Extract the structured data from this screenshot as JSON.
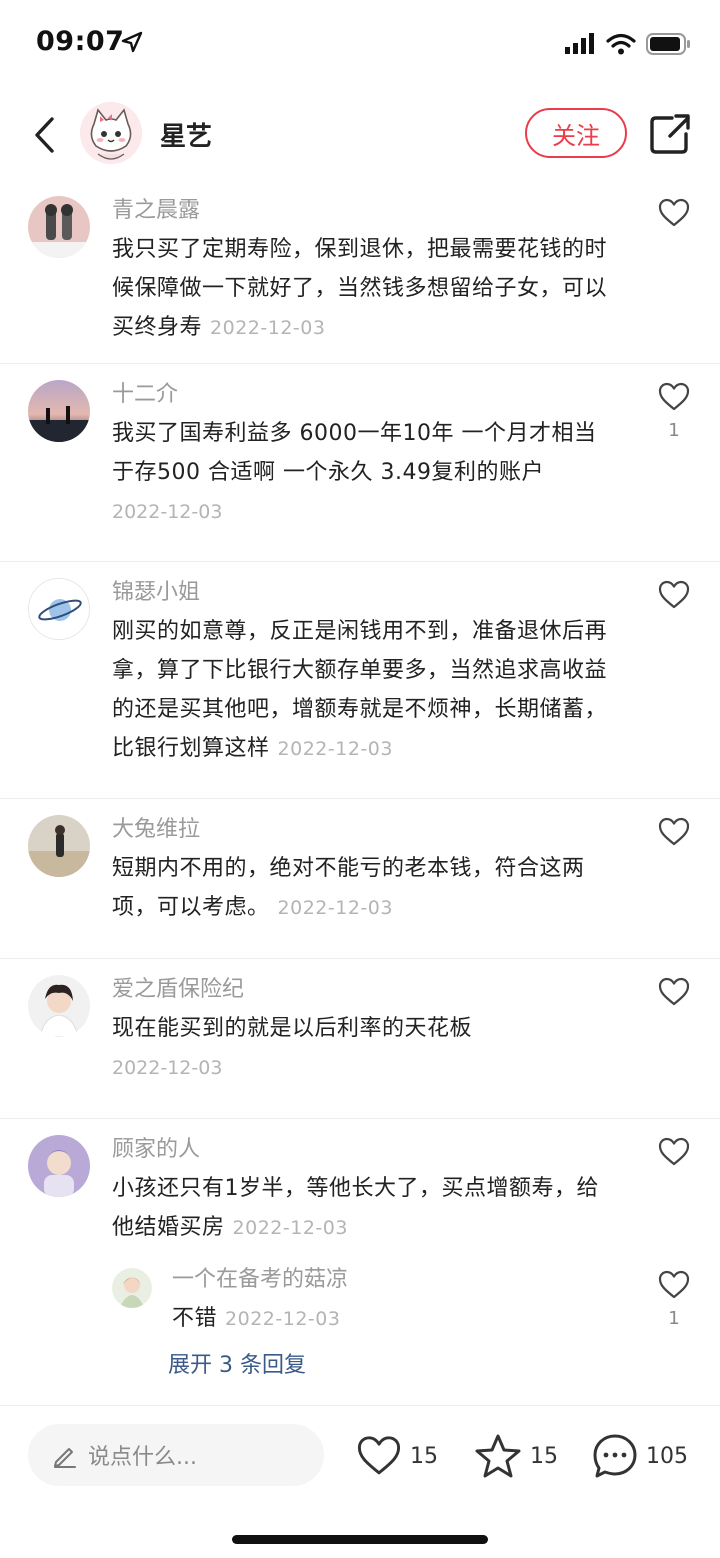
{
  "status": {
    "time": "09:07"
  },
  "header": {
    "name": "星艺",
    "follow_label": "关注"
  },
  "comments": [
    {
      "user": "青之晨露",
      "body": "我只买了定期寿险，保到退休，把最需要花钱的时候保障做一下就好了，当然钱多想留给子女，可以买终身寿",
      "date": "2022-12-03",
      "likes": ""
    },
    {
      "user": "十二介",
      "body": "我买了国寿利益多 6000一年10年 一个月才相当于存500  合适啊 一个永久 3.49复利的账户",
      "date": "2022-12-03",
      "likes": "1"
    },
    {
      "user": "锦瑟小姐",
      "body": "刚买的如意尊，反正是闲钱用不到，准备退休后再拿，算了下比银行大额存单要多，当然追求高收益的还是买其他吧，增额寿就是不烦神，长期储蓄，比银行划算这样",
      "date": "2022-12-03",
      "likes": ""
    },
    {
      "user": "大兔维拉",
      "body": "短期内不用的，绝对不能亏的老本钱，符合这两项，可以考虑。",
      "date": "2022-12-03",
      "likes": ""
    },
    {
      "user": "爱之盾保险纪",
      "body": "现在能买到的就是以后利率的天花板",
      "date": "2022-12-03",
      "likes": ""
    },
    {
      "user": "顾家的人",
      "body": "小孩还只有1岁半，等他长大了，买点增额寿，给他结婚买房",
      "date": "2022-12-03",
      "likes": "",
      "reply": {
        "user": "一个在备考的菇凉",
        "body": "不错",
        "date": "2022-12-03",
        "likes": "1"
      },
      "expand_label": "展开 3 条回复"
    }
  ],
  "bottom": {
    "input_placeholder": "说点什么...",
    "likes": "15",
    "stars": "15",
    "comments": "105"
  },
  "colors": {
    "accent": "#ec3b4a",
    "link": "#3b5a8a"
  }
}
